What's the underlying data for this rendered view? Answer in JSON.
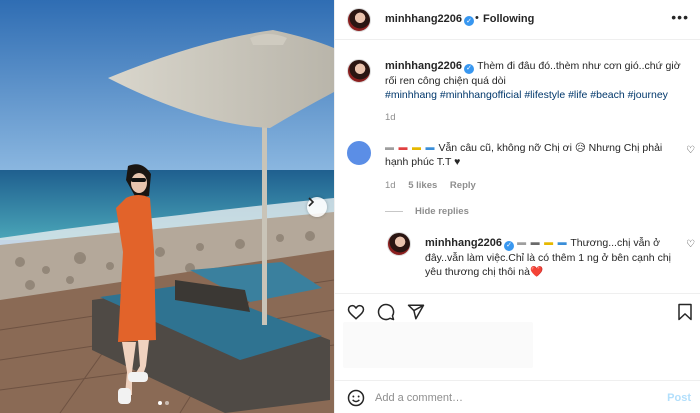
{
  "post": {
    "username": "minhhang2206",
    "follow_status": "Following",
    "more_icon": "more-horizontal-icon",
    "caption": "Thèm đi đâu đó..thèm như cơn gió..chứ giờ rối ren công chiện quá dòi",
    "hashtags": "#minhhang #minhhangofficial #lifestyle #life #beach #journey",
    "caption_time": "1d",
    "carousel": {
      "next_icon": "chevron-right-icon",
      "slides": 2,
      "active_slide": 1
    }
  },
  "comments": [
    {
      "masked_user": "▬ ▬ ▬ ▬",
      "text": "Vẫn câu cũ, không nỡ Chị ơi 😥 Nhưng Chị phải hạnh phúc T.T ♥",
      "time": "1d",
      "likes": "5 likes",
      "reply_label": "Reply",
      "hide_replies_label": "Hide replies",
      "replies": [
        {
          "username": "minhhang2206",
          "masked_user": "▬ ▬ ▬ ▬",
          "text": "Thương...chị vẫn ở đây..vẫn làm việc.Chỉ là có thêm 1 ng ở bên cạnh chị yêu thương chị thôi nà❤️"
        }
      ]
    }
  ],
  "actions": {
    "like_icon": "heart-icon",
    "comment_icon": "comment-icon",
    "share_icon": "share-icon",
    "save_icon": "bookmark-icon"
  },
  "composer": {
    "emoji_icon": "emoji-icon",
    "placeholder": "Add a comment…",
    "post_label": "Post"
  },
  "colors": {
    "verified": "#3897f0",
    "link": "#00376b",
    "post_disabled": "#b2dffc",
    "dress": "#e2632a"
  }
}
